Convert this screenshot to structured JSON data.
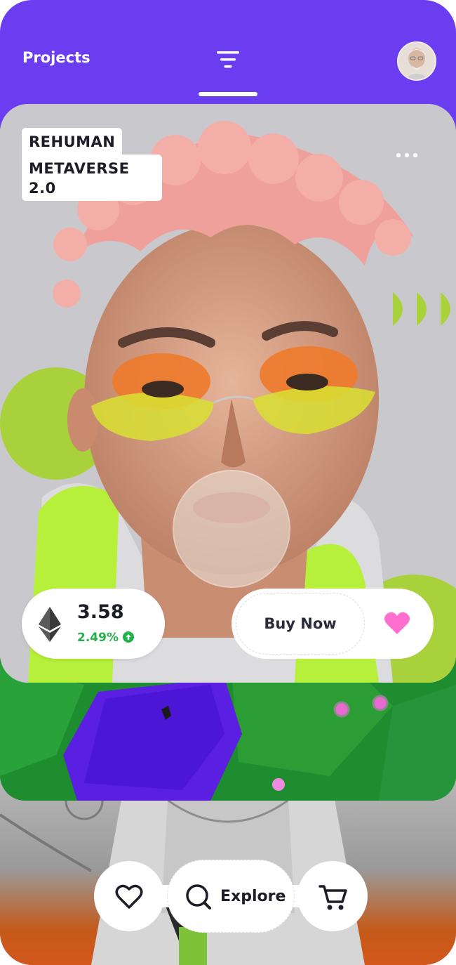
{
  "header": {
    "title": "Projects",
    "filter_icon": "filter-icon",
    "avatar_icon": "avatar"
  },
  "card": {
    "tag_line1": "REHUMAN",
    "tag_line2": "METAVERSE 2.0",
    "more_icon": "more-horizontal-icon"
  },
  "price": {
    "value": "3.58",
    "change": "2.49%",
    "currency_icon": "ethereum-icon",
    "trend_icon": "arrow-up-icon"
  },
  "actions": {
    "buy_label": "Buy Now",
    "like_icon": "heart-icon"
  },
  "bottom_nav": {
    "like_icon": "heart-outline-icon",
    "search_icon": "search-icon",
    "explore_label": "Explore",
    "cart_icon": "cart-icon"
  },
  "colors": {
    "accent": "#6a3df0",
    "positive": "#22b24c",
    "heart": "#ff6fd0",
    "lime": "#a8d13a"
  }
}
